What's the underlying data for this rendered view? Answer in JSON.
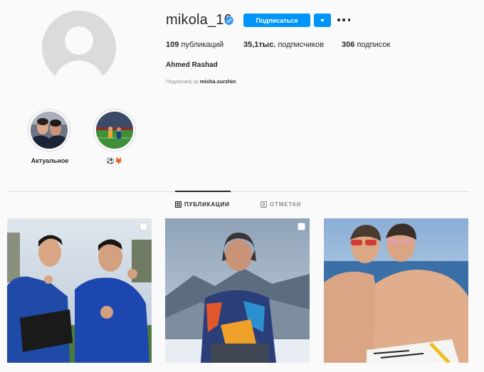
{
  "profile": {
    "username": "mikola_16",
    "verified": true,
    "follow_label": "Подписаться",
    "stats": {
      "posts_count": "109",
      "posts_label": "публикаций",
      "followers_count": "35,1тыс.",
      "followers_label": "подписчиков",
      "following_count": "306",
      "following_label": "подписок"
    },
    "full_name": "Ahmed Rashad",
    "followed_by_prefix": "Подписан(-а)",
    "followed_by_user": "misha.surzhin"
  },
  "highlights": [
    {
      "label": "Актуальное"
    },
    {
      "label": "⚽🦊"
    }
  ],
  "tabs": [
    {
      "label": "ПУБЛИКАЦИИ",
      "active": true
    },
    {
      "label": "ОТМЕТКИ",
      "active": false
    }
  ],
  "colors": {
    "accent": "#0095f6",
    "verified": "#3897f0",
    "text": "#262626",
    "muted": "#8e8e8e",
    "border": "#dbdbdb",
    "background": "#fafafa"
  }
}
